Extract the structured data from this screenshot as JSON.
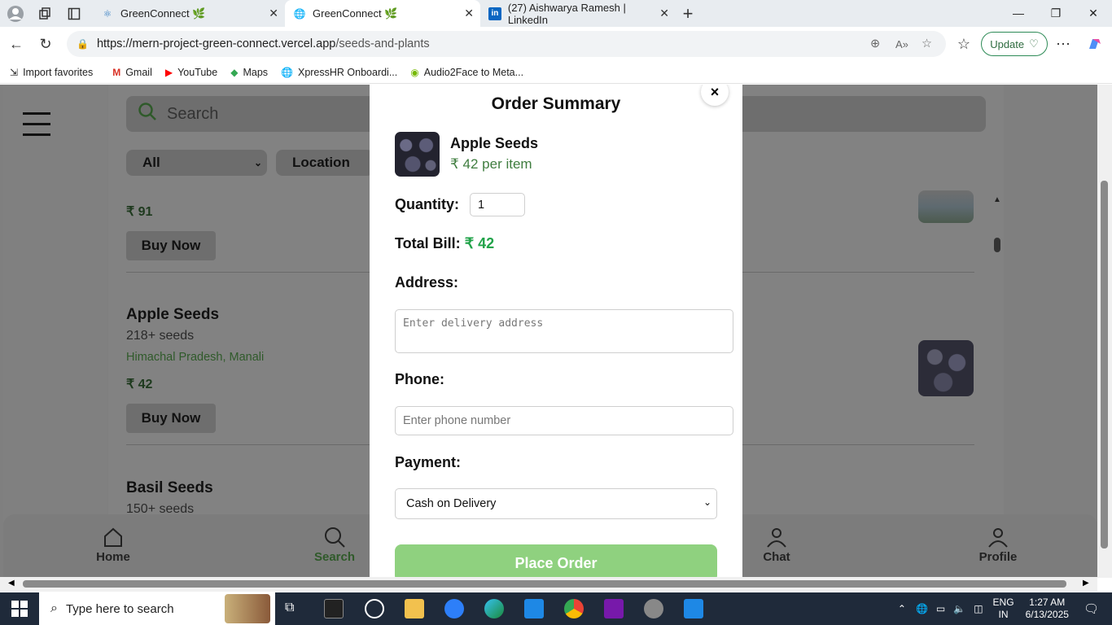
{
  "browser": {
    "tabs": [
      {
        "title": "GreenConnect 🌿",
        "icon": "react-icon"
      },
      {
        "title": "GreenConnect 🌿",
        "icon": "globe-icon"
      },
      {
        "title": "(27) Aishwarya Ramesh | LinkedIn",
        "icon": "linkedin-icon"
      }
    ],
    "url_host": "https://mern-project-green-connect.vercel.app",
    "url_path": "/seeds-and-plants",
    "update_label": "Update",
    "bookmarks": [
      "Import favorites",
      "Gmail",
      "YouTube",
      "Maps",
      "XpressHR Onboardi...",
      "Audio2Face to Meta..."
    ]
  },
  "app": {
    "search_placeholder": "Search",
    "filters": {
      "category": "All",
      "location": "Location"
    },
    "items": [
      {
        "price": "₹ 91",
        "buy_label": "Buy Now"
      },
      {
        "name": "Apple Seeds",
        "count": "218+ seeds",
        "location": "Himachal Pradesh, Manali",
        "price": "₹ 42",
        "buy_label": "Buy Now"
      },
      {
        "name": "Basil Seeds",
        "count": "150+ seeds"
      }
    ],
    "bottom_nav": [
      {
        "label": "Home",
        "icon": "home-icon"
      },
      {
        "label": "Search",
        "icon": "search-icon",
        "active": true
      },
      {
        "label": "Chat",
        "icon": "chat-icon"
      },
      {
        "label": "Profile",
        "icon": "profile-icon"
      }
    ]
  },
  "modal": {
    "title": "Order Summary",
    "close": "×",
    "product_name": "Apple Seeds",
    "product_price": "₹ 42 per item",
    "quantity_label": "Quantity:",
    "quantity_value": "1",
    "total_label": "Total Bill:",
    "total_value": "₹ 42",
    "address_label": "Address:",
    "address_placeholder": "Enter delivery address",
    "phone_label": "Phone:",
    "phone_placeholder": "Enter phone number",
    "payment_label": "Payment:",
    "payment_value": "Cash on Delivery",
    "place_order": "Place Order"
  },
  "colors": {
    "accent_green": "#22a34a",
    "button_green": "#8fd17f",
    "price_green": "#3f7d3f"
  },
  "taskbar": {
    "search_placeholder": "Type here to search",
    "lang": "ENG",
    "region": "IN",
    "time": "1:27 AM",
    "date": "6/13/2025"
  }
}
